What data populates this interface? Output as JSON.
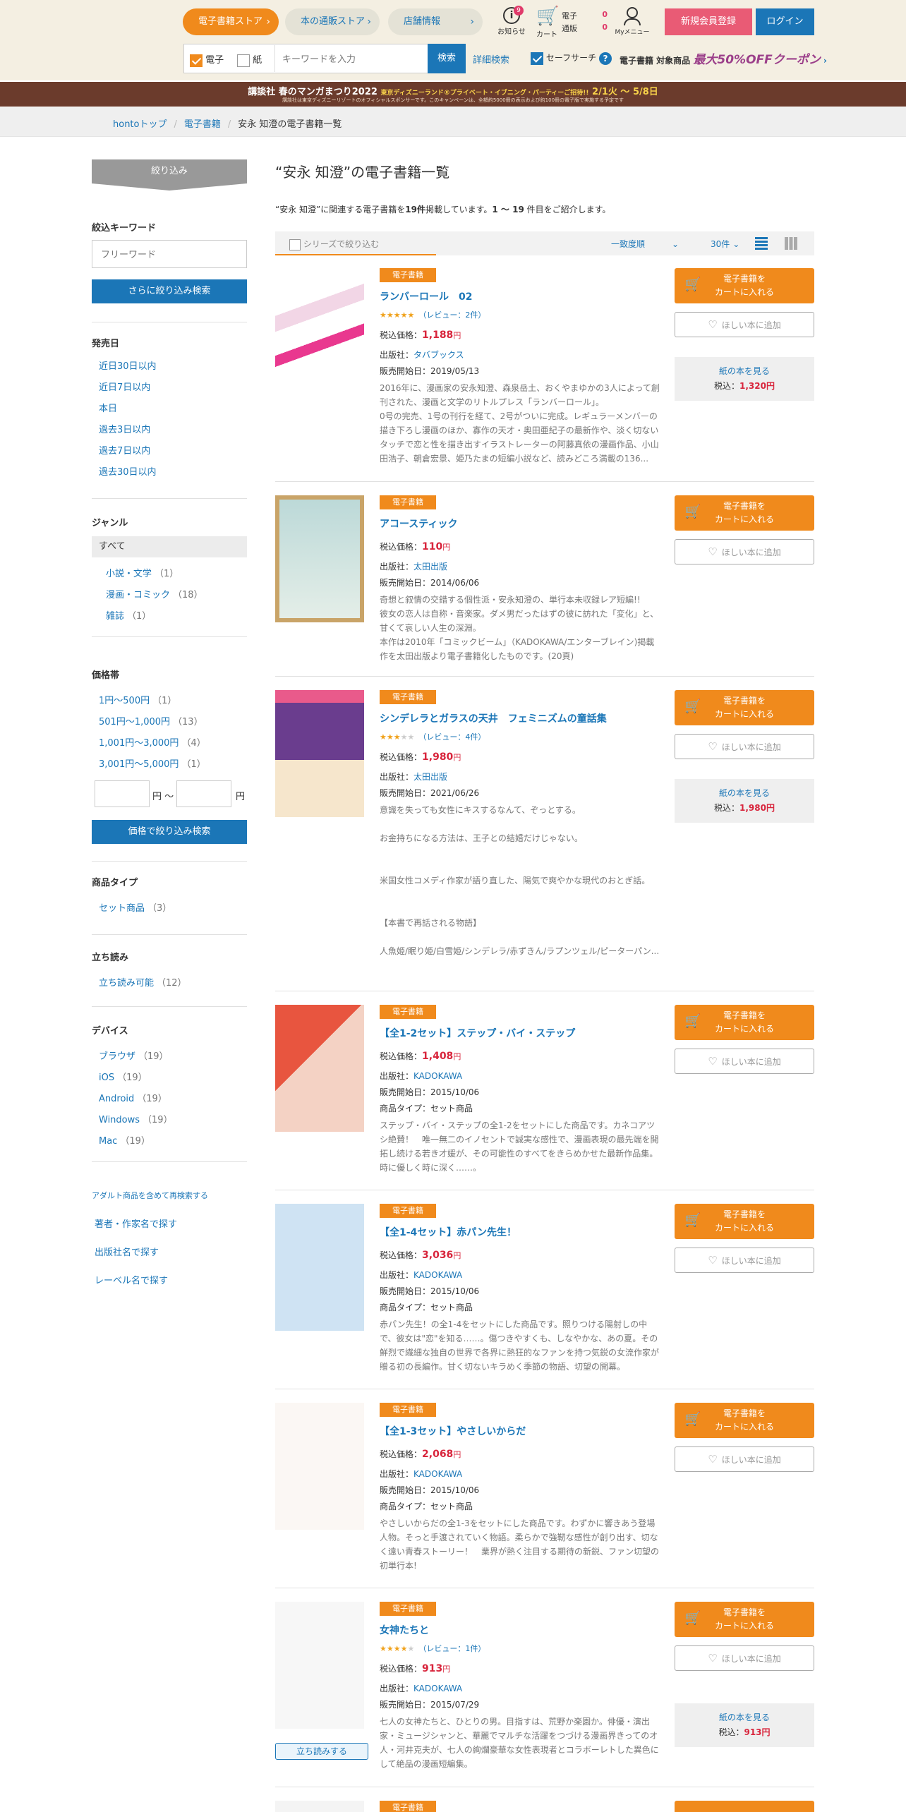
{
  "header": {
    "nav": [
      "電子書籍ストア",
      "本の通販ストア",
      "店舗情報"
    ],
    "notice_label": "お知らせ",
    "notice_count": "9",
    "cart_label": "カート",
    "cart_rows": [
      {
        "label": "電子",
        "count": "0"
      },
      {
        "label": "通販",
        "count": "0"
      }
    ],
    "mymenu_label": "Myメニュー",
    "register": "新規会員登録",
    "login": "ログイン"
  },
  "search": {
    "chk_elec": "電子",
    "chk_paper": "紙",
    "placeholder": "キーワードを入力",
    "button": "検索",
    "advanced": "詳細検索",
    "safe": "セーフサーチ",
    "coupon_pre": "電子書籍 対象商品",
    "coupon_big": "最大50%OFFクーポン"
  },
  "banner": {
    "line1": "講談社 春のマンガまつり2022",
    "line1_hl": "東京ディズニーランド®プライベート・イブニング・パーティーご招待!!",
    "dates": "2/1火 ～ 5/8日",
    "line2": "講談社は東京ディズニーリゾートのオフィシャルスポンサーです。このキャンペーンは、全額約5000冊の表示および約100冊の電子版で実施する予定です"
  },
  "breadcrumb": [
    "hontoトップ",
    "電子書籍",
    "安永 知澄の電子書籍一覧"
  ],
  "sidebar": {
    "narrow": "絞り込み",
    "kw_title": "絞込キーワード",
    "kw_placeholder": "フリーワード",
    "kw_button": "さらに絞り込み検索",
    "date_title": "発売日",
    "dates": [
      "近日30日以内",
      "近日7日以内",
      "本日",
      "過去3日以内",
      "過去7日以内",
      "過去30日以内"
    ],
    "genre_title": "ジャンル",
    "genre_all": "すべて",
    "genres": [
      {
        "label": "小説・文学",
        "count": "（1）"
      },
      {
        "label": "漫画・コミック",
        "count": "（18）"
      },
      {
        "label": "雑誌",
        "count": "（1）"
      }
    ],
    "price_title": "価格帯",
    "prices": [
      {
        "label": "1円〜500円",
        "count": "（1）"
      },
      {
        "label": "501円〜1,000円",
        "count": "（13）"
      },
      {
        "label": "1,001円〜3,000円",
        "count": "（4）"
      },
      {
        "label": "3,001円〜5,000円",
        "count": "（1）"
      }
    ],
    "yen_sep": "円 ～",
    "yen": "円",
    "price_button": "価格で絞り込み検索",
    "type_title": "商品タイプ",
    "types": [
      {
        "label": "セット商品",
        "count": "（3）"
      }
    ],
    "tachi_title": "立ち読み",
    "tachi": [
      {
        "label": "立ち読み可能",
        "count": "（12）"
      }
    ],
    "device_title": "デバイス",
    "devices": [
      {
        "label": "ブラウザ",
        "count": "（19）"
      },
      {
        "label": "iOS",
        "count": "（19）"
      },
      {
        "label": "Android",
        "count": "（19）"
      },
      {
        "label": "Windows",
        "count": "（19）"
      },
      {
        "label": "Mac",
        "count": "（19）"
      }
    ],
    "adult": "アダルト商品を含めて再検索する",
    "links": [
      "著者・作家名で探す",
      "出版社名で探す",
      "レーベル名で探す"
    ]
  },
  "main": {
    "title": "“安永 知澄”の電子書籍一覧",
    "desc_pre": "“安永 知澄”に関連する電子書籍を",
    "desc_count": "19件",
    "desc_mid": "掲載しています。",
    "desc_range": "1 ～ 19",
    "desc_post": " 件目をご紹介します。",
    "series": "シリーズで絞り込む",
    "sort": "一致度順",
    "perpage": "30件"
  },
  "labels": {
    "tag": "電子書籍",
    "cart": "電子書籍を",
    "cart2": "カートに入れる",
    "wish": "ほしい本に追加",
    "paper": "紙の本を見る",
    "tax": "税込価格：",
    "tax_short": "税込：",
    "yen": "円",
    "tachiyomi": "立ち読みする",
    "publisher_pre": "出版社：",
    "date_pre": "販売開始日：",
    "type_pre": "商品タイプ："
  },
  "items": [
    {
      "title": "ランバーロール　02",
      "stars": 4.5,
      "review": "（レビュー：2件）",
      "price": "1,188",
      "publisher": "タバブックス",
      "date": "2019/05/13",
      "paper_price": "1,320",
      "desc": "2016年に、漫画家の安永知澄、森泉岳土、おくやまゆかの3人によって創刊された、漫画と文学のリトルプレス「ランバーロール」。\n0号の完売、1号の刊行を経て、2号がついに完成。レギュラーメンバーの描き下ろし漫画のほか、寡作の天才・奥田亜紀子の最新作や、淡く切ないタッチで恋と性を描き出すイラストレーターの阿藤真依の漫画作品、小山田浩子、朝倉宏景、姫乃たまの短編小説など、読みどころ満載の136..."
    },
    {
      "title": "アコースティック",
      "price": "110",
      "publisher": "太田出版",
      "date": "2014/06/06",
      "desc": "奇想と叙情の交錯する個性派・安永知澄の、単行本未収録レア短編!!\n彼女の恋人は自称・音楽家。ダメ男だったはずの彼に訪れた「変化」と、甘くて哀しい人生の深淵。\n本作は2010年「コミックビーム」（KADOKAWA/エンターブレイン)掲載作を太田出版より電子書籍化したものです。(20頁)"
    },
    {
      "title": "シンデレラとガラスの天井　フェミニズムの童話集",
      "stars": 3,
      "review": "（レビュー：4件）",
      "price": "1,980",
      "publisher": "太田出版",
      "date": "2021/06/26",
      "paper_price": "1,980",
      "desc": "意識を失っても女性にキスするなんて、ぞっとする。\n\nお金持ちになる方法は、王子との結婚だけじゃない。\n\n\n米国女性コメディ作家が語り直した、陽気で爽やかな現代のおとぎ話。\n\n\n【本書で再話される物語】\n\n人魚姫/眠り姫/白雪姫/シンデレラ/赤ずきん/ラプンツェル/ピーターパン..."
    },
    {
      "title": "【全1-2セット】ステップ・バイ・ステップ",
      "price": "1,408",
      "publisher": "KADOKAWA",
      "date": "2015/10/06",
      "type": "セット商品",
      "desc": "ステップ・バイ・ステップの全1-2をセットにした商品です。カネコアツシ絶賛！　唯一無二のイノセントで誠実な感性で、漫画表現の最先端を開拓し続ける若き才媛が、その可能性のすべてをきらめかせた最新作品集。時に優しく時に深く……。"
    },
    {
      "title": "【全1-4セット】赤パン先生！",
      "price": "3,036",
      "publisher": "KADOKAWA",
      "date": "2015/10/06",
      "type": "セット商品",
      "desc": "赤パン先生！の全1-4をセットにした商品です。照りつける陽射しの中で、彼女は\"恋\"を知る……。傷つきやすくも、しなやかな、あの夏。その鮮烈で繊細な独自の世界で各界に熱狂的なファンを持つ気鋭の女流作家が贈る初の長編作。甘く切ないキラめく季節の物語、切望の開幕。"
    },
    {
      "title": "【全1-3セット】やさしいからだ",
      "price": "2,068",
      "publisher": "KADOKAWA",
      "date": "2015/10/06",
      "type": "セット商品",
      "desc": "やさしいからだの全1-3をセットにした商品です。わずかに響きあう登場人物。そっと手渡されていく物語。柔らかで強靭な感性が創り出す、切なく遠い青春ストーリー！　業界が熱く注目する期待の新鋭、ファン切望の初単行本!"
    },
    {
      "title": "女神たちと",
      "stars": 4,
      "review": "（レビュー：1件）",
      "price": "913",
      "publisher": "KADOKAWA",
      "date": "2015/07/29",
      "paper_price": "913",
      "tachiyomi": true,
      "desc": "七人の女神たちと、ひとりの男。目指すは、荒野か楽園か。俳優・演出家・ミュージシャンと、華麗でマルチな活躍をつづける漫画界きってのオ人・河井克夫が、七人の絢爛豪華な女性表現者とコラボーレトした異色にして絶品の漫画短編集。"
    }
  ],
  "colors": {
    "accent": "#f08a1c",
    "brand": "#1b76b7",
    "price": "#d8253c",
    "pink": "#e95b75"
  }
}
